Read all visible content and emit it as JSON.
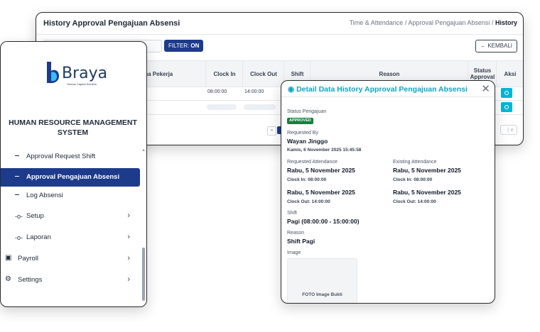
{
  "main": {
    "title": "History Approval Pengajuan Absensi",
    "breadcrumb": {
      "part1": "Time & Attendance",
      "sep": "/",
      "part2": "Approval Pengajuan Absensi",
      "current": "History"
    },
    "filter": {
      "label": "FILTER:",
      "value": "ON"
    },
    "back_button": "← KEMBALI",
    "columns": {
      "nama": "ma Pekerja",
      "clock_in": "Clock In",
      "clock_out": "Clock Out",
      "shift": "Shift",
      "reason": "Reason",
      "status": "Status Approval",
      "aksi": "Aksi"
    },
    "rows": [
      {
        "clock_in": "08:00:00",
        "clock_out": "14:00:00"
      }
    ],
    "pager_prev": "«",
    "pager_size": "| ∨"
  },
  "sidebar": {
    "brand": "Braya",
    "tagline": "Human Capital Solution",
    "system_title": "HUMAN RESOURCE MANAGEMENT SYSTEM",
    "items": [
      {
        "label": "Approval Request Shift"
      },
      {
        "label": "Approval Pengajuan Absensi"
      },
      {
        "label": "Log Absensi"
      },
      {
        "label": "Setup"
      },
      {
        "label": "Laporan"
      },
      {
        "label": "Payroll"
      },
      {
        "label": "Settings"
      }
    ]
  },
  "modal": {
    "title": "Detail Data History Approval Pengajuan Absensi",
    "status_label": "Status Pengajuan",
    "status": "APPROVED",
    "requested_by_label": "Requested By",
    "requested_by": "Wayan Jinggo",
    "requested_at": "Kamis, 6 November 2025 15:45:58",
    "requested_att_label": "Requested Attendance",
    "existing_att_label": "Existing Attendance",
    "req_in_date": "Rabu, 5 November 2025",
    "req_in_time": "Clock In: 08:00:00",
    "req_out_date": "Rabu, 5 November 2025",
    "req_out_time": "Clock Out: 14:00:00",
    "ex_in_date": "Rabu, 5 November 2025",
    "ex_in_time": "Clock In: 08:00:00",
    "ex_out_date": "Rabu, 5 November 2025",
    "ex_out_time": "Clock Out: 14:00:00",
    "shift_label": "Shift",
    "shift": "Pagi (08:00:00 - 15:00:00)",
    "reason_label": "Reason",
    "reason": "Shift Pagi",
    "image_label": "Image",
    "image_caption": "FOTO Image Bukti"
  },
  "colors": {
    "primary": "#1e3a8a",
    "accent": "#06b6d4",
    "success": "#15803d"
  }
}
